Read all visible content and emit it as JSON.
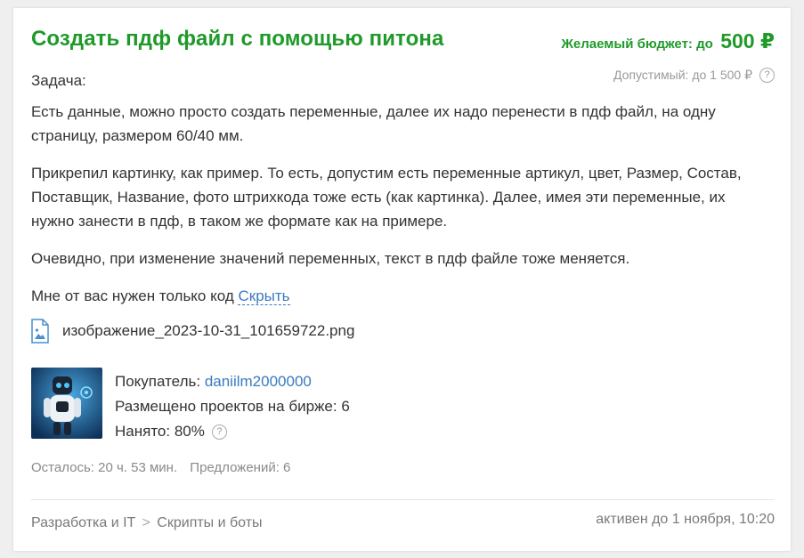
{
  "title": "Создать пдф файл с помощью питона",
  "budget": {
    "label": "Желаемый бюджет: до",
    "amount": "500 ₽",
    "allowed": "Допустимый: до 1 500 ₽",
    "help_icon": "question-circle-icon"
  },
  "description": {
    "task_label": "Задача:",
    "paragraphs": [
      "Есть данные, можно просто создать переменные, далее их надо перенести в пдф файл, на одну страницу, размером 60/40 мм.",
      "Прикрепил картинку, как пример. То есть, допустим есть переменные артикул, цвет, Размер, Состав, Поставщик, Название, фото штрихкода тоже есть (как картинка). Далее, имея эти переменные, их нужно занести в пдф, в таком же формате как на примере.",
      "Очевидно, при изменение значений переменных, текст в пдф файле тоже меняется."
    ],
    "last_line": "Мне от вас нужен только код",
    "hide_link": "Скрыть"
  },
  "attachment": {
    "icon": "image-file-icon",
    "filename": "изображение_2023-10-31_101659722.png"
  },
  "buyer": {
    "label": "Покупатель:",
    "username": "daniilm2000000",
    "projects_label": "Размещено проектов на бирже:",
    "projects_count": "6",
    "hired_label": "Нанято:",
    "hired_value": "80%",
    "help_icon": "question-circle-icon"
  },
  "meta": {
    "remaining": "Осталось: 20 ч. 53 мин.",
    "offers": "Предложений: 6"
  },
  "footer": {
    "breadcrumbs": [
      "Разработка и IT",
      "Скрипты и боты"
    ],
    "separator": ">",
    "active_until": "активен до 1 ноября, 10:20"
  },
  "colors": {
    "accent_green": "#1f9a2a",
    "link_blue": "#3a7bbf",
    "muted": "#9a9a9a"
  }
}
